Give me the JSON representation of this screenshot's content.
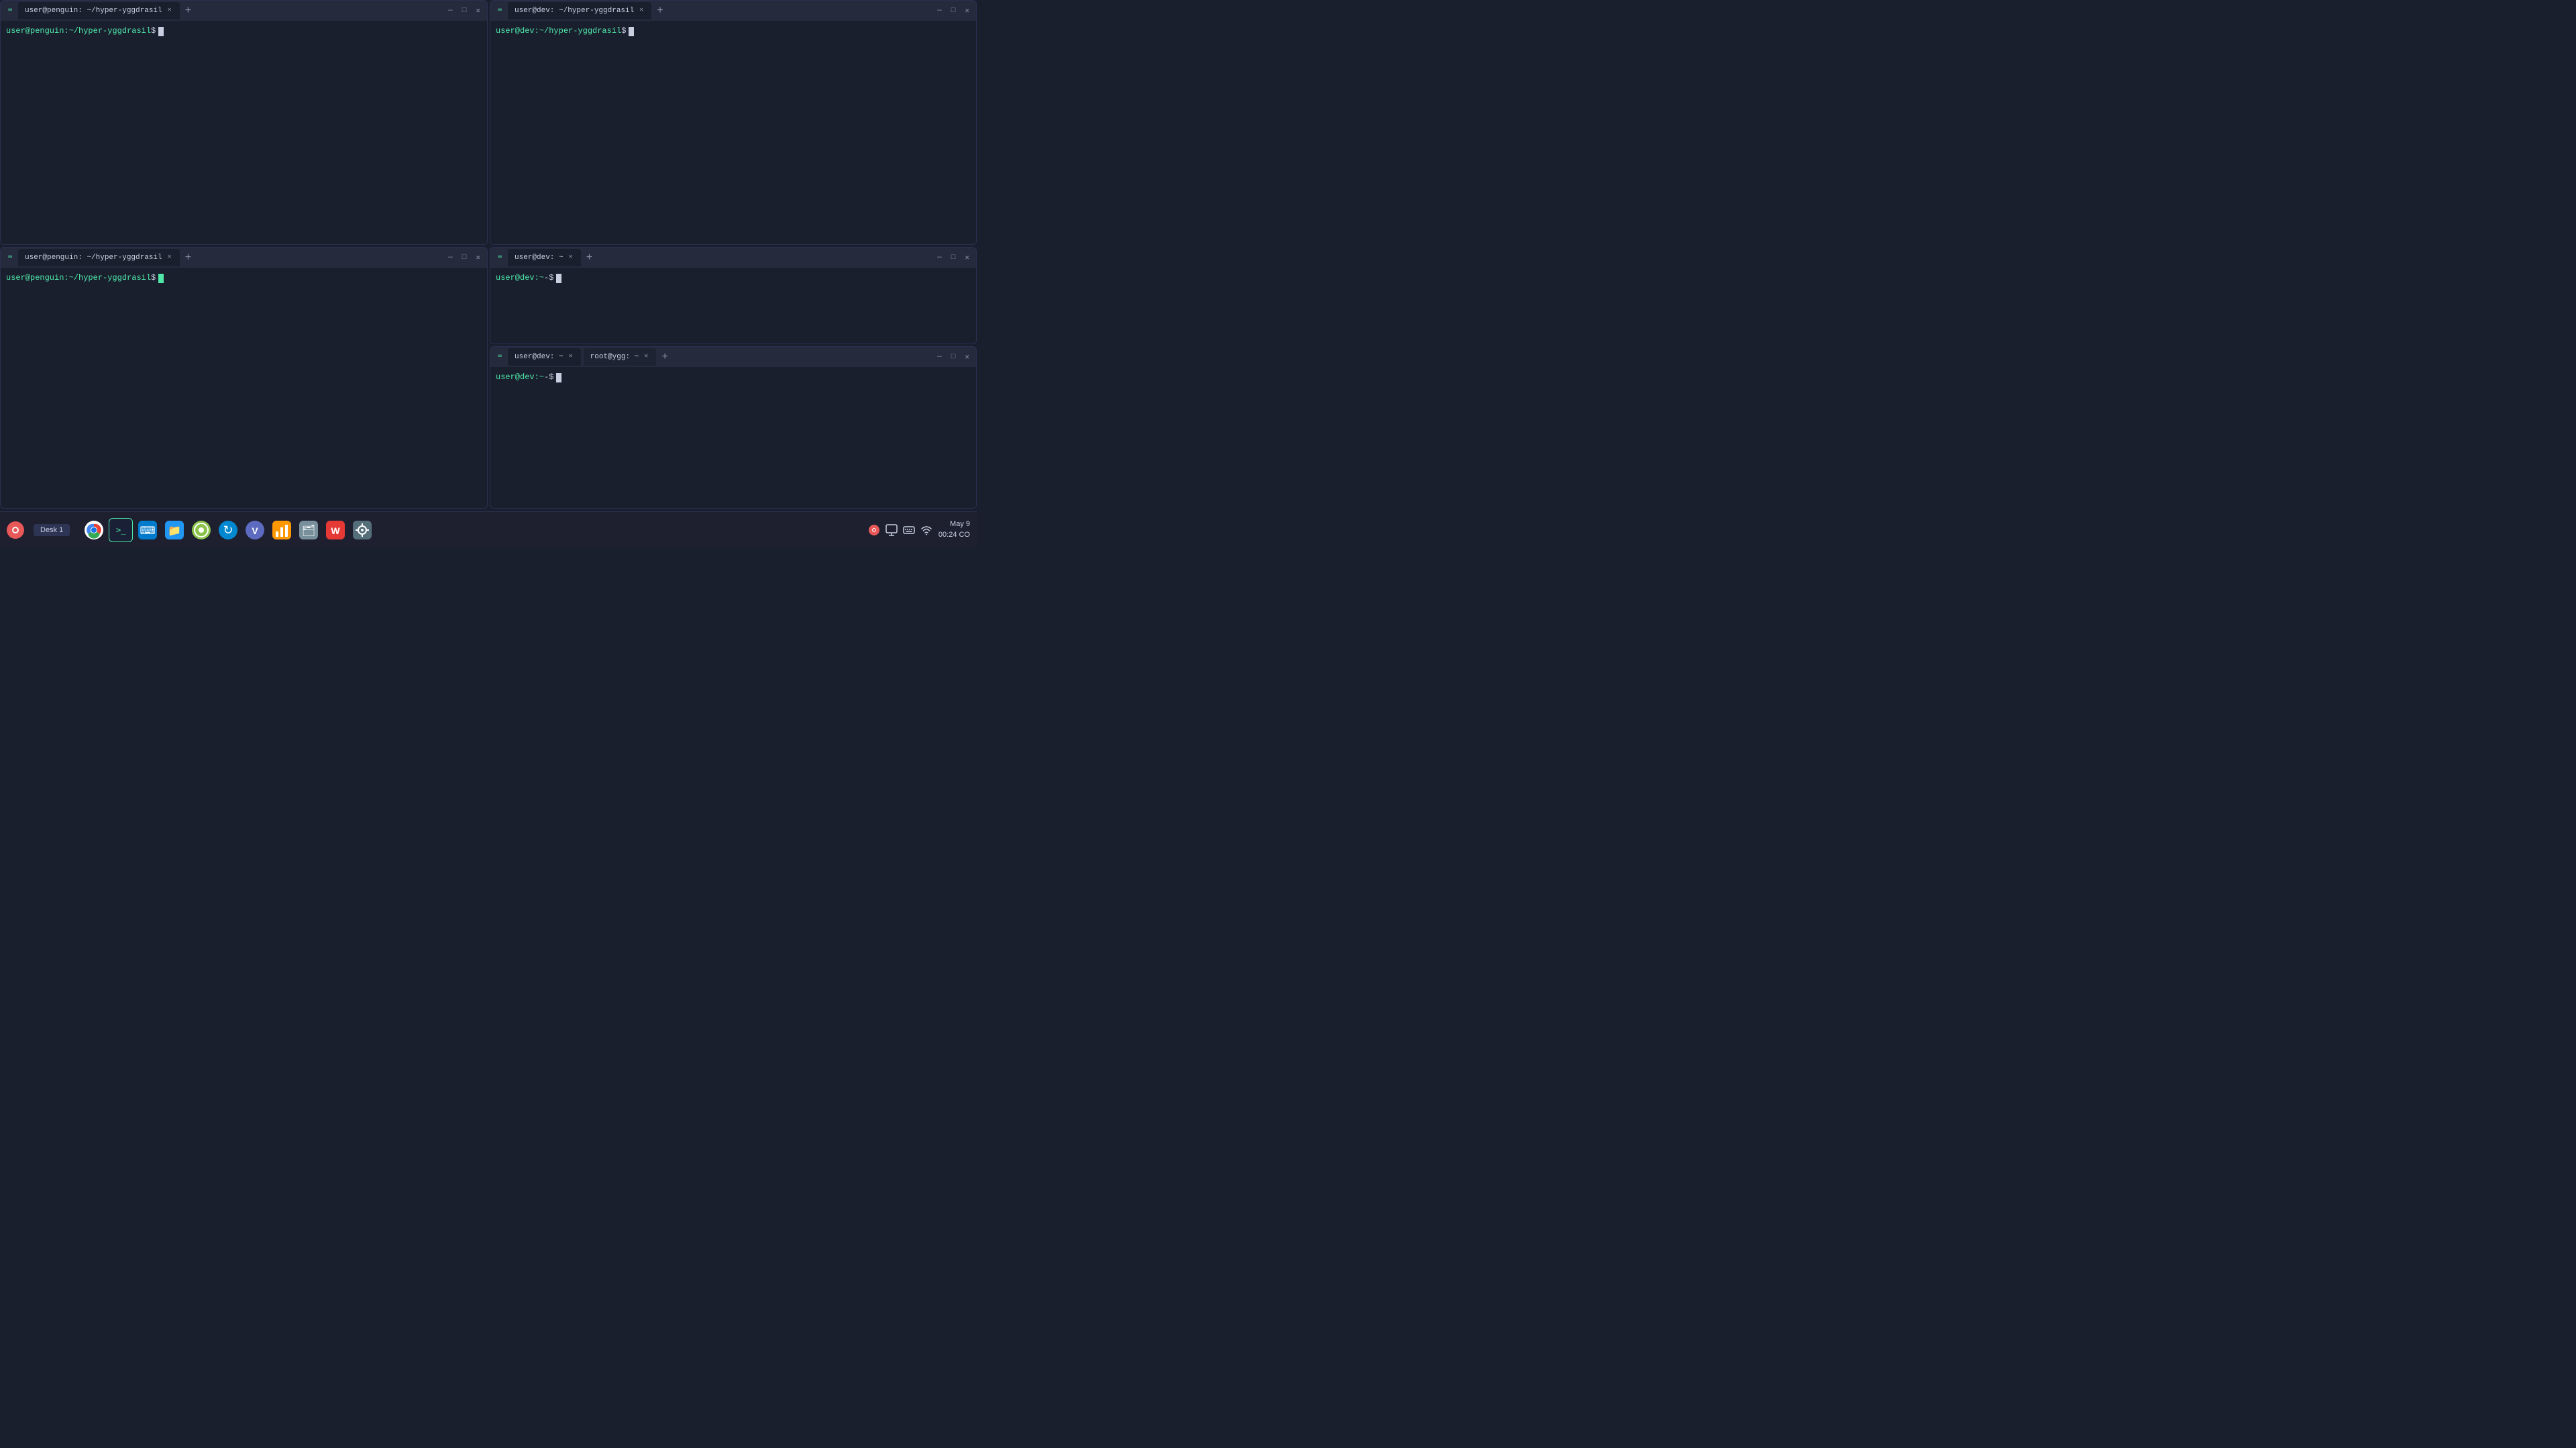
{
  "windows": [
    {
      "id": "win1",
      "tabs": [
        {
          "label": "user@penguin: ~/hyper-yggdrasil",
          "active": true,
          "closable": true
        }
      ],
      "prompt": {
        "user": "user@penguin",
        "path": ":~/hyper-yggdrasil",
        "dollar": "$",
        "cursor": "block"
      }
    },
    {
      "id": "win2",
      "tabs": [
        {
          "label": "user@dev: ~/hyper-yggdrasil",
          "active": true,
          "closable": true
        }
      ],
      "prompt": {
        "user": "user@dev",
        "path": ":~/hyper-yggdrasil",
        "dollar": "$",
        "cursor": "block"
      }
    },
    {
      "id": "win3",
      "tabs": [
        {
          "label": "user@penguin: ~/hyper-yggdrasil",
          "active": true,
          "closable": true
        }
      ],
      "prompt": {
        "user": "user@penguin",
        "path": ":~/hyper-yggdrasil",
        "dollar": "$",
        "cursor": "bar"
      }
    },
    {
      "id": "win4",
      "tabs": [
        {
          "label": "user@dev: ~",
          "active": true,
          "closable": true
        }
      ],
      "prompt": {
        "user": "user@dev",
        "path": ":~",
        "dollar": "-$",
        "cursor": "block"
      }
    },
    {
      "id": "win5",
      "tabs": [
        {
          "label": "user@dev: ~",
          "active": true,
          "closable": true
        },
        {
          "label": "root@ygg: ~",
          "active": false,
          "closable": true
        }
      ],
      "prompt": {
        "user": "user@dev",
        "path": ":~",
        "dollar": "-$",
        "cursor": "block"
      }
    }
  ],
  "taskbar": {
    "desk_label": "Desk 1",
    "datetime_line1": "May 9",
    "datetime_line2": "00:24 CO",
    "icons": [
      {
        "name": "chrome",
        "symbol": "⬤",
        "color": "#4285f4"
      },
      {
        "name": "terminal",
        "symbol": ">_"
      },
      {
        "name": "vscode",
        "symbol": "⬡",
        "color": "#007acc"
      },
      {
        "name": "files",
        "symbol": "📁"
      },
      {
        "name": "apps1",
        "symbol": "⬡",
        "color": "#8BC34A"
      },
      {
        "name": "refresh",
        "symbol": "↻",
        "color": "#29b6f6"
      },
      {
        "name": "vpn",
        "symbol": "V",
        "color": "#5c6bc0"
      },
      {
        "name": "chart",
        "symbol": "📊"
      },
      {
        "name": "folder",
        "symbol": "🗂"
      },
      {
        "name": "app2",
        "symbol": "W",
        "color": "#ef5350"
      },
      {
        "name": "settings",
        "symbol": "⚙"
      }
    ]
  },
  "window_controls": {
    "minimize": "—",
    "maximize": "□",
    "close": "✕"
  }
}
